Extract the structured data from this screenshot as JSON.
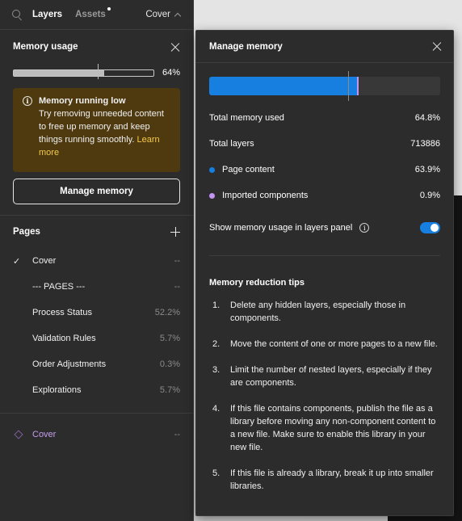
{
  "topbar": {
    "tabs": [
      {
        "label": "Layers",
        "active": true
      },
      {
        "label": "Assets",
        "active": false,
        "has_notification_dot": true
      }
    ],
    "current_page": "Cover"
  },
  "memory_panel": {
    "title": "Memory usage",
    "usage_percent_label": "64%",
    "usage_fraction": 0.648,
    "threshold_fraction": 0.6,
    "warning": {
      "title": "Memory running low",
      "body": "Try removing unneeded content to free up memory and keep things running smoothly.",
      "link": "Learn more"
    },
    "manage_button": "Manage memory"
  },
  "pages": {
    "title": "Pages",
    "items": [
      {
        "name": "Cover",
        "value": "--",
        "selected": true
      },
      {
        "name": "--- PAGES ---",
        "value": "--",
        "selected": false
      },
      {
        "name": "Process Status",
        "value": "52.2%",
        "selected": false
      },
      {
        "name": "Validation Rules",
        "value": "5.7%",
        "selected": false
      },
      {
        "name": "Order Adjustments",
        "value": "0.3%",
        "selected": false
      },
      {
        "name": "Explorations",
        "value": "5.7%",
        "selected": false
      }
    ]
  },
  "layers": [
    {
      "name": "Cover",
      "value": "--",
      "icon": "frame-diamond-icon"
    }
  ],
  "modal": {
    "title": "Manage memory",
    "bar": {
      "page_content_fraction": 0.639,
      "imported_components_fraction": 0.009,
      "threshold_fraction": 0.6
    },
    "stats": [
      {
        "label": "Total memory used",
        "value": "64.8%"
      },
      {
        "label": "Total layers",
        "value": "713886"
      },
      {
        "label": "Page content",
        "value": "63.9%",
        "color": "#167fe0"
      },
      {
        "label": "Imported components",
        "value": "0.9%",
        "color": "#c394f2"
      }
    ],
    "toggle": {
      "label": "Show memory usage in layers panel",
      "on": true
    },
    "tips_title": "Memory reduction tips",
    "tips": [
      {
        "num": "1.",
        "text": "Delete any hidden layers, especially those in components."
      },
      {
        "num": "2.",
        "text": "Move the content of one or more pages to a new file."
      },
      {
        "num": "3.",
        "text": "Limit the number of nested layers, especially if they are components."
      },
      {
        "num": "4.",
        "text": "If this file contains components, publish the file as a library before moving any non-component content to a new file. Make sure to enable this library in your new file."
      },
      {
        "num": "5.",
        "text": "If this file is already a library, break it up into smaller libraries."
      }
    ]
  },
  "colors": {
    "accent_blue": "#167fe0",
    "component_purple": "#c394f2",
    "warning_bg": "#4f3a10",
    "warning_link": "#f5c94a"
  }
}
